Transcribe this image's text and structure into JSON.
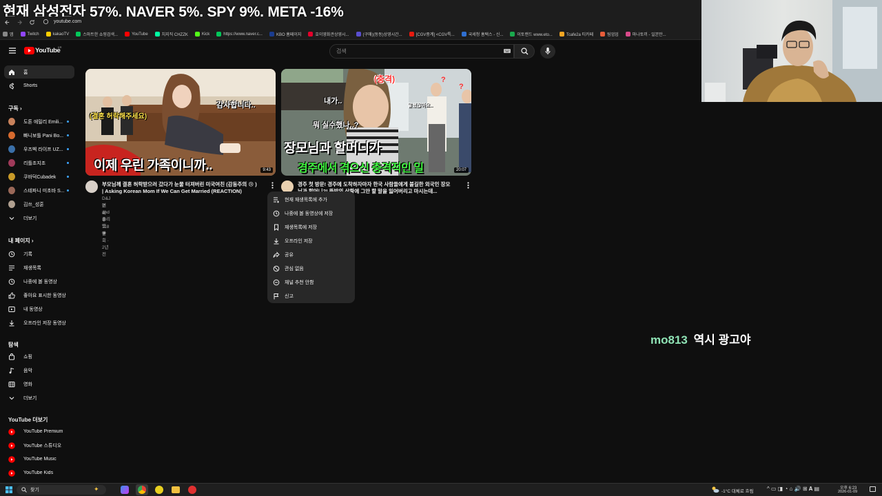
{
  "banner": {
    "text": "현재 삼성전자 57%, NAVER 5%, SPY 9%, META -16%",
    "tab_fragment": "Tub"
  },
  "browser": {
    "url": "youtube.com"
  },
  "bookmarks": [
    {
      "label": "앱",
      "color": "#888888"
    },
    {
      "label": "Twitch",
      "color": "#9146ff"
    },
    {
      "label": "kakaoTV",
      "color": "#ffcd00"
    },
    {
      "label": "스마트한 쇼핑검색...",
      "color": "#03c75a"
    },
    {
      "label": "YouTube",
      "color": "#ff0000"
    },
    {
      "label": "치지직 CHZZK",
      "color": "#00ffa3"
    },
    {
      "label": "Kick",
      "color": "#53fc18"
    },
    {
      "label": "https://www.naver.c...",
      "color": "#03c75a"
    },
    {
      "label": "KBO 홈페이지",
      "color": "#1a3c8f"
    },
    {
      "label": "호이영화관상영시...",
      "color": "#e4002b"
    },
    {
      "label": "(구매)(동동)상영시간...",
      "color": "#5a4fcf"
    },
    {
      "label": "[CGV중계] <CGV특...",
      "color": "#e71a0f"
    },
    {
      "label": "국세청 홈택스 - 신...",
      "color": "#2f6fd0"
    },
    {
      "label": "이토랜드 www.eto...",
      "color": "#1aa94d"
    },
    {
      "label": "Tcafe2a 티카페",
      "color": "#f5a623"
    },
    {
      "label": "팀업업",
      "color": "#e85d3a"
    },
    {
      "label": "마나토끼 - 일본만...",
      "color": "#d84a8a"
    }
  ],
  "header": {
    "logo_text": "YouTube",
    "country": "KR",
    "search_placeholder": "검색"
  },
  "sidebar": {
    "main": [
      {
        "label": "홈",
        "icon": "home-icon",
        "active": true
      },
      {
        "label": "Shorts",
        "icon": "shorts-icon",
        "active": false
      }
    ],
    "subs_header": "구독",
    "subscriptions": [
      {
        "label": "도톤 에밀리 Emili...",
        "color": "#c9825c"
      },
      {
        "label": "빠니보틀 Pani Bo...",
        "color": "#d66a2e"
      },
      {
        "label": "우즈벡 라이프 UZ...",
        "color": "#3a6fa8"
      },
      {
        "label": "리틀조지조",
        "color": "#a03a5a"
      },
      {
        "label": "쿠바덕Cubadek",
        "color": "#c89a28"
      },
      {
        "label": "스테파니 미초바 S...",
        "color": "#9a6858"
      },
      {
        "label": "김쓰_성훈",
        "color": "#b0a090"
      }
    ],
    "subs_more": "더보기",
    "you_header": "내 페이지",
    "you": [
      {
        "label": "기록",
        "icon": "history-icon"
      },
      {
        "label": "재생목록",
        "icon": "playlist-icon"
      },
      {
        "label": "나중에 볼 동영상",
        "icon": "clock-icon"
      },
      {
        "label": "좋아요 표시한 동영상",
        "icon": "thumbs-up-icon"
      },
      {
        "label": "내 동영상",
        "icon": "my-videos-icon"
      },
      {
        "label": "오프라인 저장 동영상",
        "icon": "download-icon"
      }
    ],
    "explore_header": "탐색",
    "explore": [
      {
        "label": "쇼핑",
        "icon": "shopping-bag-icon"
      },
      {
        "label": "음악",
        "icon": "music-note-icon"
      },
      {
        "label": "영화",
        "icon": "film-icon"
      },
      {
        "label": "더보기",
        "icon": "chevron-down-icon"
      }
    ],
    "more_header": "YouTube 더보기",
    "more": [
      {
        "label": "YouTube Premium"
      },
      {
        "label": "YouTube 스튜디오"
      },
      {
        "label": "YouTube Music"
      },
      {
        "label": "YouTube Kids"
      }
    ]
  },
  "videos": [
    {
      "thumb_top_text": "(결혼 허락해주세요)",
      "thumb_side_text": "감사합니다..",
      "thumb_bottom_text": "이제 우린 가족이니까..",
      "duration": "9:43",
      "title_line1": "부모님께 결혼 허락받으러 갔다가 눈물 터져버린 미국여친 (감동주의",
      "title_line2": "| Asking Korean Mom If We Can Get Married (REACTION)",
      "channel": "D&J던 and 줄리앳",
      "meta": "조회수 118만회 · 2년 전"
    },
    {
      "thumb_top_text": "(충격)",
      "thumb_mid_text1": "내가..",
      "thumb_mid_text2": "뭐 실수했나..?",
      "thumb_side_text": "말했잖아요..",
      "thumb_big_text": "장모님과 할머니가",
      "thumb_green_text": "경주에서 겪으신 충격적인 일",
      "duration": "20:07",
      "title_line1": "경주 첫 방문! 경주에 도착하자마자 한국 사람들에게 불길한 외국인 장모",
      "title_line2": "님과 할머니?! 뜻밖의 상황에 그만 할 말을 잃어버리고 마시는데..."
    }
  ],
  "context_menu": [
    {
      "label": "현재 재생목록에 추가",
      "icon": "queue-icon"
    },
    {
      "label": "나중에 볼 동영상에 저장",
      "icon": "clock-icon"
    },
    {
      "label": "재생목록에 저장",
      "icon": "bookmark-icon"
    },
    {
      "label": "오프라인 저장",
      "icon": "download-icon"
    },
    {
      "label": "공유",
      "icon": "share-icon"
    },
    {
      "label": "관심 없음",
      "icon": "block-icon"
    },
    {
      "label": "채널 추천 안함",
      "icon": "minus-circle-icon"
    },
    {
      "label": "신고",
      "icon": "flag-icon"
    }
  ],
  "chat": {
    "user": "mo813",
    "message": "역시 광고야",
    "user_color": "#8fe3b5"
  },
  "taskbar": {
    "search_label": "찾기",
    "weather": "-1°C  대체로 흐림",
    "time": "오후 6:23",
    "date": "2026-01-09"
  }
}
